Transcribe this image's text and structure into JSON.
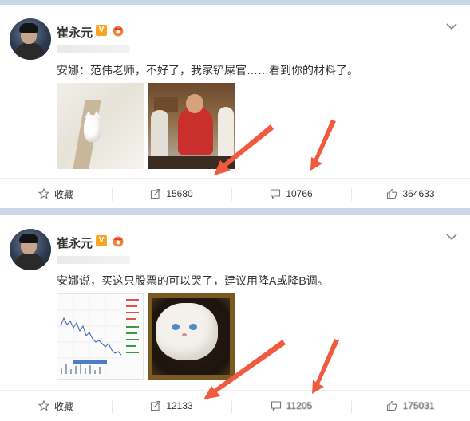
{
  "accent_color": "#f05a3e",
  "posts": [
    {
      "username": "崔永元",
      "text": "安娜：范伟老师，不好了，我家铲屎官……看到你的材料了。",
      "actions": {
        "favorite_label": "收藏",
        "repost_count": "15680",
        "comment_count": "10766",
        "like_count": "364633"
      },
      "icons": [
        "star-icon",
        "share-icon",
        "comment-icon",
        "thumbs-up-icon"
      ]
    },
    {
      "username": "崔永元",
      "text": "安娜说，买这只股票的可以哭了，建议用降A或降B调。",
      "actions": {
        "favorite_label": "收藏",
        "repost_count": "12133",
        "comment_count": "11205",
        "like_count": "175031"
      },
      "icons": [
        "star-icon",
        "share-icon",
        "comment-icon",
        "thumbs-up-icon"
      ]
    }
  ]
}
